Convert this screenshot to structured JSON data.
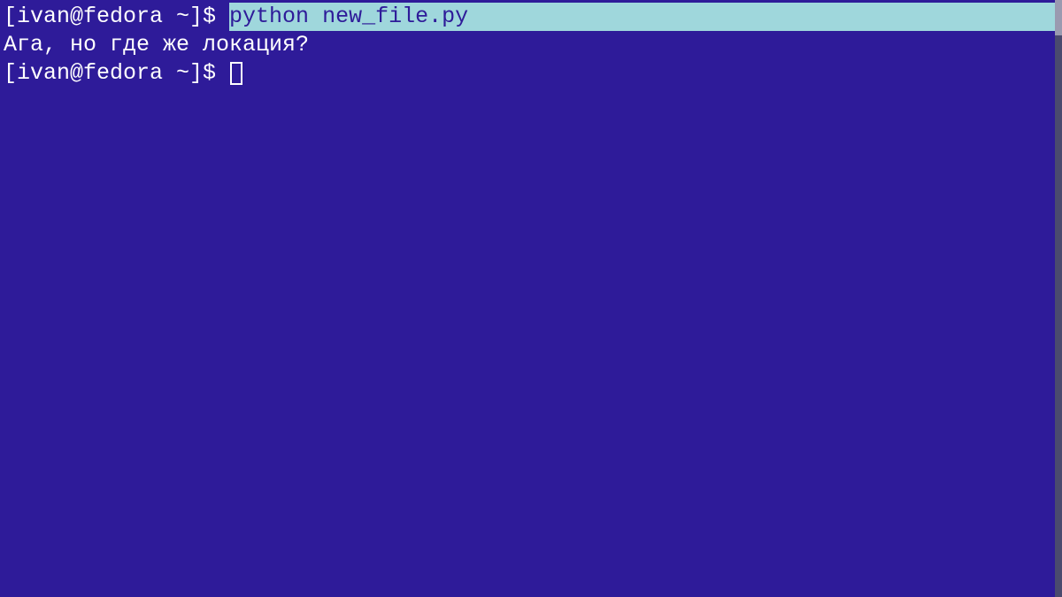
{
  "terminal": {
    "lines": [
      {
        "prompt": "[ivan@fedora ~]$ ",
        "command": "python new_file.py"
      },
      {
        "output": "Ага, но где же локация?"
      },
      {
        "prompt": "[ivan@fedora ~]$ ",
        "cursor": true
      }
    ]
  },
  "colors": {
    "background": "#2e1b99",
    "text": "#ffffff",
    "highlight_bg": "#9fd7dc",
    "highlight_fg": "#2e1b99"
  }
}
